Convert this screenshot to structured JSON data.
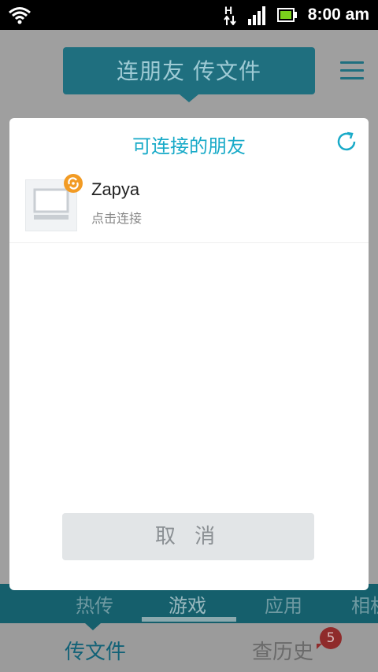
{
  "status": {
    "time": "8:00 am",
    "network_label": "H"
  },
  "header": {
    "title": "连朋友 传文件"
  },
  "dialog": {
    "title": "可连接的朋友",
    "items": [
      {
        "name": "Zapya",
        "status": "点击连接"
      }
    ],
    "cancel_label": "取 消"
  },
  "tabs": [
    "热传",
    "游戏",
    "应用",
    "相机"
  ],
  "bottom": {
    "left_label": "传文件",
    "right_label": "查历史",
    "badge_count": "5"
  },
  "colors": {
    "accent": "#18aac8",
    "teal_header": "#1f6f7f",
    "badge_red": "#8f2b2b"
  }
}
